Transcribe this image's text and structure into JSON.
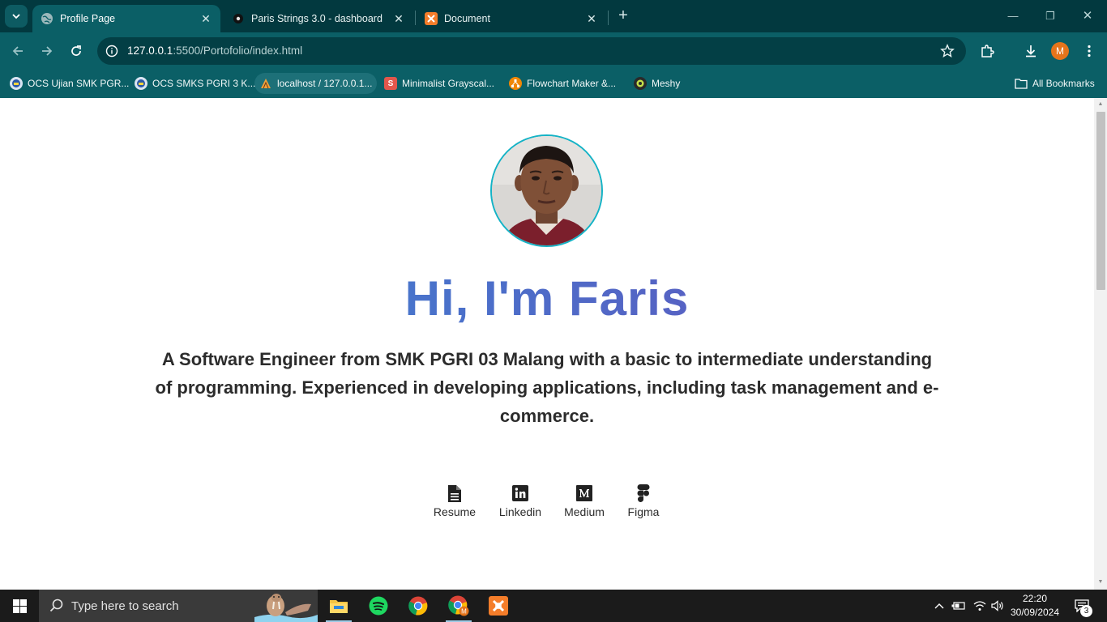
{
  "browser": {
    "tabs": [
      {
        "title": "Profile Page",
        "icon": "globe-icon",
        "active": true
      },
      {
        "title": "Paris Strings 3.0 - dashboard",
        "icon": "dark-circle-icon",
        "active": false
      },
      {
        "title": "Document",
        "icon": "xampp-icon",
        "active": false
      }
    ],
    "url": {
      "host": "127.0.0.1",
      "path": ":5500/Portofolio/index.html"
    },
    "profile_initial": "M",
    "bookmarks": [
      {
        "label": "OCS Ujian SMK PGR...",
        "icon": "school-logo-icon"
      },
      {
        "label": "OCS SMKS PGRI 3 K...",
        "icon": "school-logo-icon"
      },
      {
        "label": "localhost / 127.0.0.1...",
        "icon": "phpmyadmin-icon"
      },
      {
        "label": "Minimalist Grayscal...",
        "icon": "slides-s-icon"
      },
      {
        "label": "Flowchart Maker &...",
        "icon": "drawio-icon"
      },
      {
        "label": "Meshy",
        "icon": "meshy-icon"
      }
    ],
    "all_bookmarks_label": "All Bookmarks"
  },
  "page": {
    "greeting": "Hi, I'm Faris",
    "bio": "A Software Engineer from SMK PGRI 03 Malang with a basic to intermediate understanding of programming. Experienced in developing applications, including task management and e-commerce.",
    "links": [
      {
        "label": "Resume",
        "icon": "document-icon"
      },
      {
        "label": "Linkedin",
        "icon": "linkedin-icon"
      },
      {
        "label": "Medium",
        "icon": "medium-icon"
      },
      {
        "label": "Figma",
        "icon": "figma-icon"
      }
    ],
    "colors": {
      "avatar_border": "#14b3c6",
      "gradient_start": "#3b8fd6",
      "gradient_end": "#6b4bb8"
    }
  },
  "taskbar": {
    "search_placeholder": "Type here to search",
    "apps": [
      "file-explorer-icon",
      "spotify-icon",
      "chrome-icon",
      "chrome-profile-icon",
      "xampp-icon"
    ],
    "time": "22:20",
    "date": "30/09/2024",
    "notification_count": "3"
  }
}
